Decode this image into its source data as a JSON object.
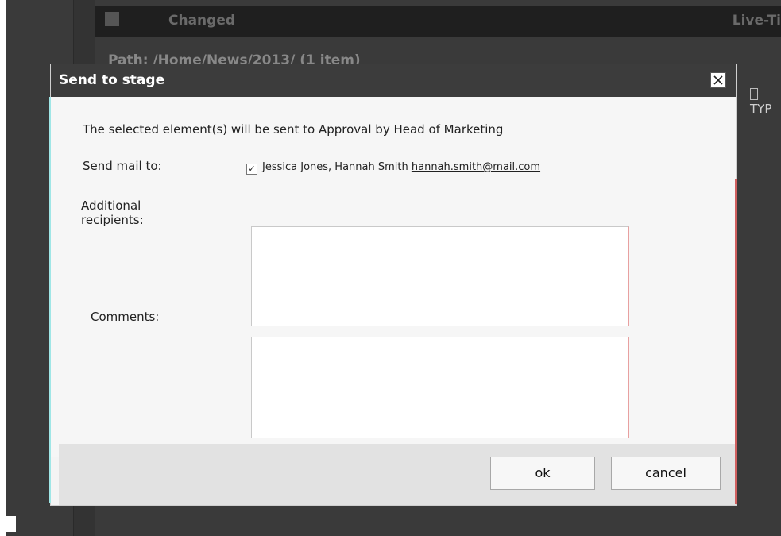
{
  "background": {
    "header_col_changed": "Changed",
    "header_col_live": "Live-Ti",
    "path_text": "Path: /Home/News/2013/ (1 item)",
    "type_label": "TYP"
  },
  "dialog": {
    "title": "Send to stage",
    "intro_text": "The selected element(s) will be sent to Approval by Head of Marketing",
    "send_mail_label": "Send mail to:",
    "send_mail_value_prefix": "Jessica Jones, Hannah Smith",
    "send_mail_value_addr": "hannah.smith@mail.com",
    "additional_recipients_label": "Additional recipients:",
    "additional_recipients_value": "",
    "comments_label": "Comments:",
    "comments_value": "",
    "ok_label": "ok",
    "cancel_label": "cancel",
    "check_mark": "✓"
  },
  "colors": {
    "titlebar": "#3c3c3c",
    "dialog_bg": "#f6f6f6",
    "footer_bg": "#e2e2e2",
    "page_bg": "#3a3a3a"
  }
}
